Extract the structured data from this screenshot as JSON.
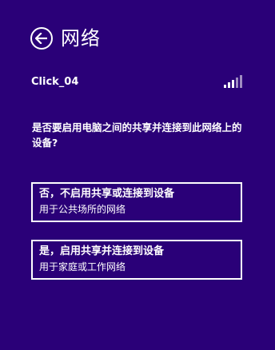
{
  "header": {
    "title": "网络",
    "back_icon": "back-arrow-icon"
  },
  "network": {
    "name": "Click_04",
    "signal_bars": 5,
    "signal_strength": 3
  },
  "question": "是否要启用电脑之间的共享并连接到此网络上的设备?",
  "options": [
    {
      "title": "否，不启用共享或连接到设备",
      "subtitle": "用于公共场所的网络"
    },
    {
      "title": "是，启用共享并连接到设备",
      "subtitle": "用于家庭或工作网络"
    }
  ],
  "colors": {
    "background": "#2a0078",
    "foreground": "#ffffff"
  }
}
